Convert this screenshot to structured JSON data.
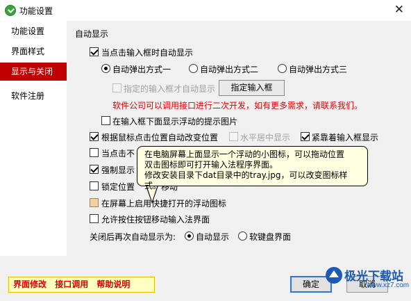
{
  "window": {
    "title": "功能设置",
    "close": "✕"
  },
  "sidebar": {
    "items": [
      {
        "label": "功能设置",
        "active": false
      },
      {
        "label": "界面样式",
        "active": false
      },
      {
        "label": "显示与关闭",
        "active": true
      },
      {
        "label": "软件注册",
        "active": false
      }
    ]
  },
  "main": {
    "section_label": "自动显示",
    "auto_show_on_input": {
      "label": "当点击输入框时自动显示",
      "checked": true
    },
    "popup_modes": [
      {
        "label": "自动弹出方式一",
        "selected": true
      },
      {
        "label": "自动弹出方式二",
        "selected": false
      },
      {
        "label": "自动弹出方式三",
        "selected": false
      }
    ],
    "specified_input_only": {
      "label": "指定的输入框才自动显示",
      "checked": false,
      "disabled": true
    },
    "assign_input_button": "指定输入框",
    "dev_notice": "软件公司可以调用接口进行二次开发，如有更多需求，请联系我们。",
    "show_float_image": {
      "label": "在输入框下面显示浮动的提示图片",
      "checked": false
    },
    "auto_reposition": {
      "label": "根据鼠标点击位置自动改变位置",
      "checked": true
    },
    "center_horizontal": {
      "label": "水平居中显示",
      "checked": false,
      "disabled": true
    },
    "stick_to_input": {
      "label": "紧靠着输入框显示",
      "checked": true
    },
    "row5_label_part": "当点击不",
    "row6_label_part": "强制显示",
    "row6_checked": true,
    "lock_position": {
      "label_part1": "锁定位置",
      "label_part2": "移动",
      "checked": false
    },
    "float_icon": {
      "label": "在屏幕上启用快捷打开的浮动图标",
      "checked": false
    },
    "allow_move_button": {
      "label": "允许按住按钮移动输入法界面",
      "checked": false
    },
    "after_close_label": "关闭后再次自动显示为:",
    "after_close_options": [
      {
        "label": "自动显示",
        "selected": true
      },
      {
        "label": "软键盘界面",
        "selected": false
      }
    ]
  },
  "tooltip": {
    "line1": "在电脑屏幕上面显示一个浮动的小图标，可以拖动位置",
    "line2": "双击图标即可打开输入法程序界面。",
    "line3": "修改安装目录下dat目录中的tray.jpg，可以改变图标样式。"
  },
  "footer": {
    "links": [
      "界面修改",
      "接口调用",
      "帮助说明"
    ],
    "ok_label": "确定",
    "cancel_label": "取消"
  },
  "watermark": {
    "text": "极光下载站",
    "url": "www.xz7.com"
  },
  "colors": {
    "accent_red": "#c00000",
    "tooltip_bg": "#ffffe1",
    "link_red": "#e00000",
    "highlight_yellow": "#ffffc0"
  }
}
